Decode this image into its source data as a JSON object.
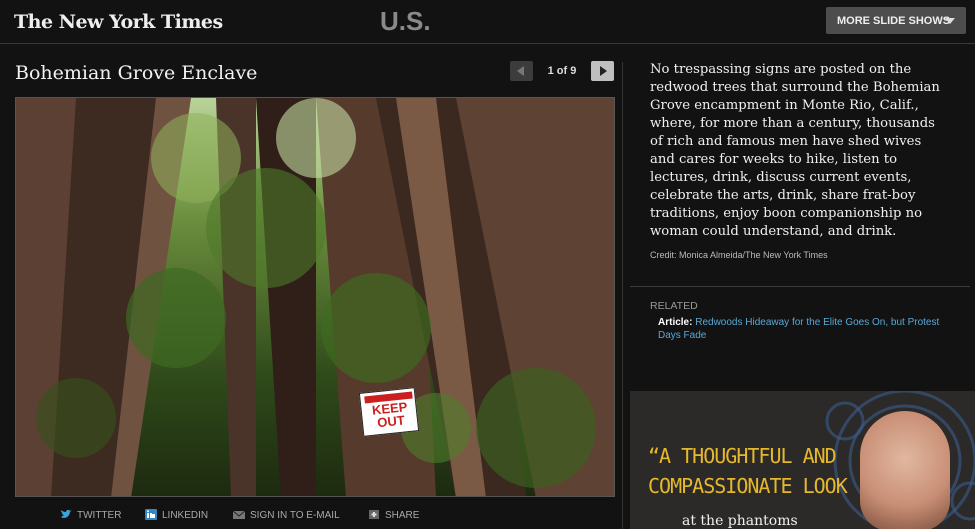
{
  "header": {
    "logo_text": "The New York Times",
    "section": "U.S.",
    "more_button": "MORE SLIDE SHOWS"
  },
  "slideshow": {
    "title": "Bohemian Grove Enclave",
    "counter": "1 of 9",
    "sign_text_small": "PRIVATE PROPERTY",
    "sign_text_main": "KEEP OUT"
  },
  "share": {
    "twitter": "TWITTER",
    "linkedin": "LINKEDIN",
    "email": "SIGN IN TO E-MAIL",
    "share": "SHARE"
  },
  "caption": {
    "text": "No trespassing signs are posted on the redwood trees that surround the Bohemian Grove encampment in Monte Rio, Calif., where, for more than a century, thousands of rich and famous men have shed wives and cares for weeks to hike, listen to lectures, drink, discuss current events, celebrate the arts, drink, share frat-boy traditions, enjoy boon companionship no woman could understand, and drink.",
    "credit": "Credit: Monica Almeida/The New York Times"
  },
  "related": {
    "label": "RELATED",
    "link_prefix": "Article:",
    "link_text": "Redwoods Hideaway for the Elite Goes On, but Protest Days Fade"
  },
  "ad": {
    "quote": "“A THOUGHTFUL AND COMPASSIONATE LOOK",
    "sub": "at the phantoms"
  },
  "colors": {
    "background": "#121212",
    "link": "#5aa9d6",
    "ad_accent": "#e6b82c",
    "sign_red": "#cc1f1f"
  }
}
